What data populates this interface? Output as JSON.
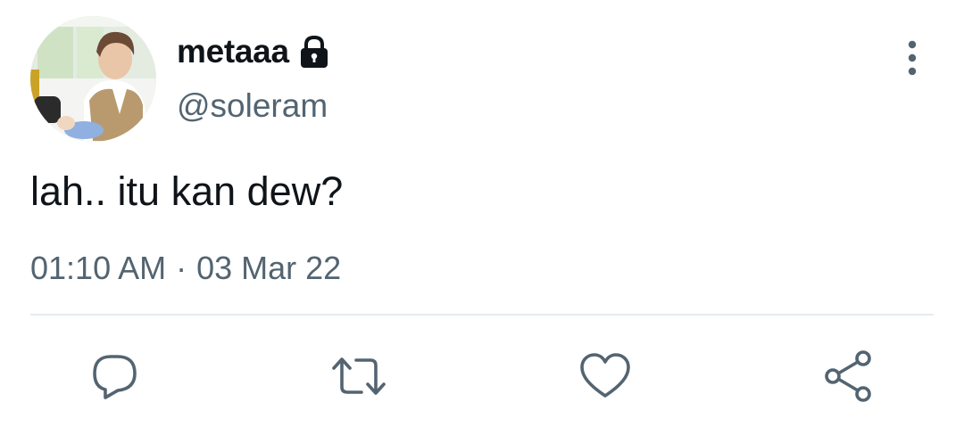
{
  "tweet": {
    "display_name": "metaaа",
    "handle": "@soleram",
    "text": "lah.. itu kan dew?",
    "time": "01:10 AM",
    "separator": "·",
    "date": "03 Mar 22"
  },
  "icons": {
    "avatar": "profile-photo",
    "protected": "lock-icon",
    "more": "more-vertical-icon",
    "reply": "reply-icon",
    "retweet": "retweet-icon",
    "like": "heart-icon",
    "share": "share-icon"
  },
  "colors": {
    "text_primary": "#0f1419",
    "text_secondary": "#536471",
    "divider": "#e6ecf0",
    "icon": "#536471"
  }
}
